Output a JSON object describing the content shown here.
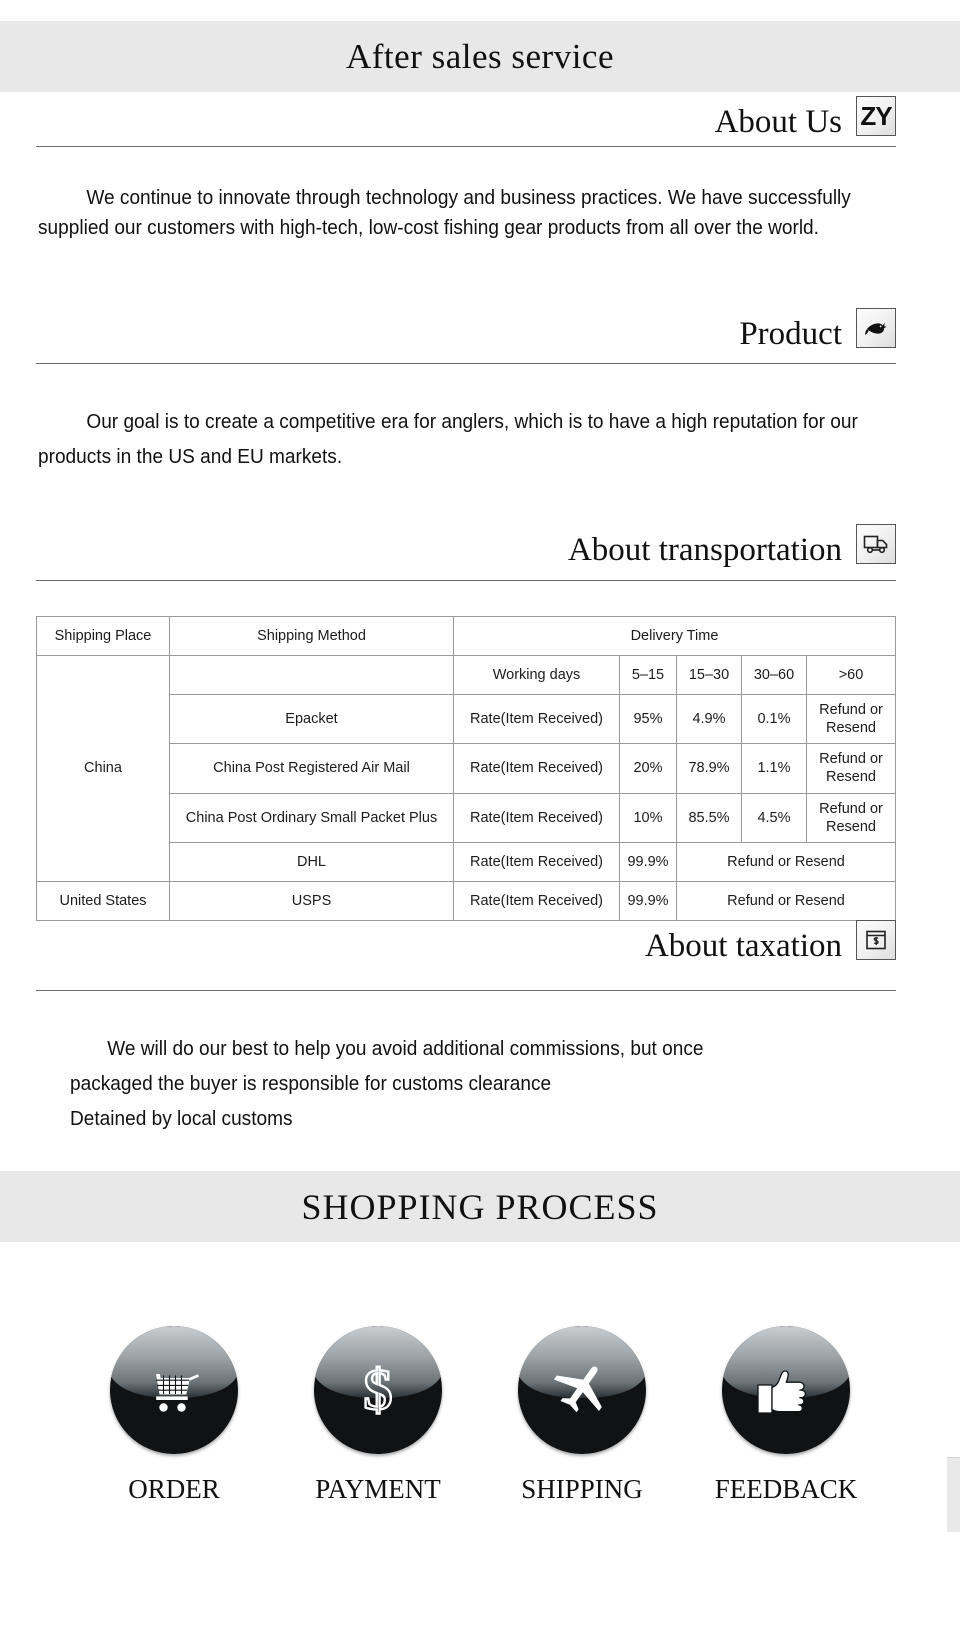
{
  "banner": {
    "title": "After sales service"
  },
  "sections": {
    "about_us": {
      "heading": "About Us",
      "badge": "ZY",
      "badge_icon": "zy-monogram-icon",
      "paragraph": "We continue to innovate through technology and business practices. We have successfully supplied our customers with high-tech, low-cost fishing gear products from all over the world."
    },
    "product": {
      "heading": "Product",
      "badge_icon": "fish-icon",
      "paragraph": "Our goal is to create a competitive era for anglers, which is to have a high reputation for our products in the US and EU markets."
    },
    "transportation": {
      "heading": "About transportation",
      "badge_icon": "delivery-truck-icon"
    },
    "taxation": {
      "heading": "About taxation",
      "badge_icon": "money-bill-icon",
      "paragraph_line1": "We will do our best to help you avoid additional commissions, but once",
      "paragraph_line2": "packaged the buyer is responsible for customs clearance",
      "paragraph_line3": "Detained by local customs"
    }
  },
  "shipping_table": {
    "headers": {
      "shipping_place": "Shipping Place",
      "shipping_method": "Shipping Method",
      "delivery_time": "Delivery Time"
    },
    "subheaders": {
      "working_days": "Working days",
      "range1": "5–15",
      "range2": "15–30",
      "range3": "30–60",
      "range4": ">60"
    },
    "rows": [
      {
        "place": "China",
        "method": "Epacket",
        "rate_label": "Rate(Item Received)",
        "v1": "95%",
        "v2": "4.9%",
        "v3": "0.1%",
        "v4": "Refund or Resend"
      },
      {
        "method": "China Post Registered Air Mail",
        "rate_label": "Rate(Item Received)",
        "v1": "20%",
        "v2": "78.9%",
        "v3": "1.1%",
        "v4": "Refund or Resend"
      },
      {
        "method": "China Post Ordinary Small Packet Plus",
        "rate_label": "Rate(Item Received)",
        "v1": "10%",
        "v2": "85.5%",
        "v3": "4.5%",
        "v4": "Refund or Resend"
      },
      {
        "method": "DHL",
        "rate_label": "Rate(Item Received)",
        "v1": "99.9%",
        "merged": "Refund or Resend"
      },
      {
        "place": "United States",
        "method": "USPS",
        "rate_label": "Rate(Item Received)",
        "v1": "99.9%",
        "merged": "Refund or Resend"
      }
    ]
  },
  "shopping_process": {
    "title": "SHOPPING PROCESS",
    "steps": [
      {
        "label": "ORDER",
        "icon": "shopping-cart-icon"
      },
      {
        "label": "PAYMENT",
        "icon": "dollar-sign-icon"
      },
      {
        "label": "SHIPPING",
        "icon": "airplane-icon"
      },
      {
        "label": "FEEDBACK",
        "icon": "thumbs-up-icon"
      }
    ]
  },
  "colors": {
    "banner_bg": "#e8e8e8",
    "rule": "#6b6b6b",
    "table_border": "#9a9a9a",
    "orb_dark": "#111214",
    "text": "#111111"
  }
}
